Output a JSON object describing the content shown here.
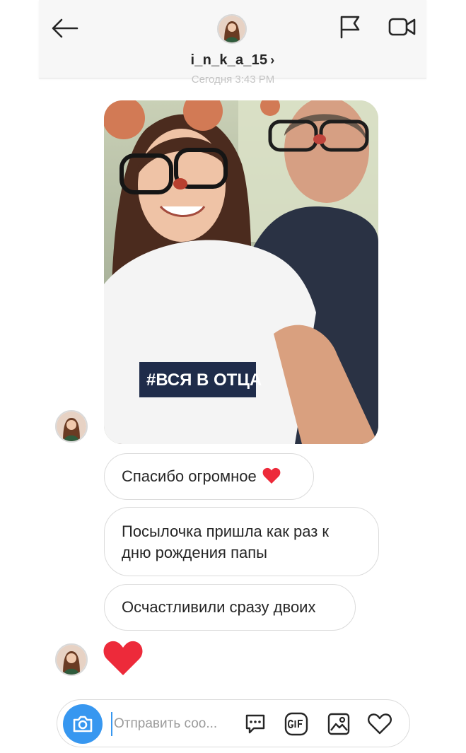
{
  "header": {
    "username": "i_n_k_a_15",
    "chevron": "›",
    "icons": {
      "back": "arrow-left-icon",
      "flag": "flag-icon",
      "video": "video-camera-icon"
    }
  },
  "timestamp": "Сегодня 3:43 PM",
  "thread": {
    "photo": {
      "caption_on_shirt": "#ВСЯ В ОТЦА"
    },
    "messages": [
      {
        "text": "Спасибо огромное",
        "emoji": "red-heart"
      },
      {
        "text": "Посылочка пришла как раз к дню рождения папы"
      },
      {
        "text": "Осчастливили сразу двоих"
      }
    ],
    "reaction": "red-heart"
  },
  "composer": {
    "placeholder": "Отправить соо...",
    "icons": [
      "camera-icon",
      "chat-bubble-icon",
      "gif-icon",
      "gallery-icon",
      "heart-outline-icon"
    ]
  },
  "colors": {
    "accent_blue": "#3797f0",
    "heart_red": "#ed2a3a",
    "bubble_border": "#dbdbdb",
    "header_bg": "#f7f7f7"
  }
}
